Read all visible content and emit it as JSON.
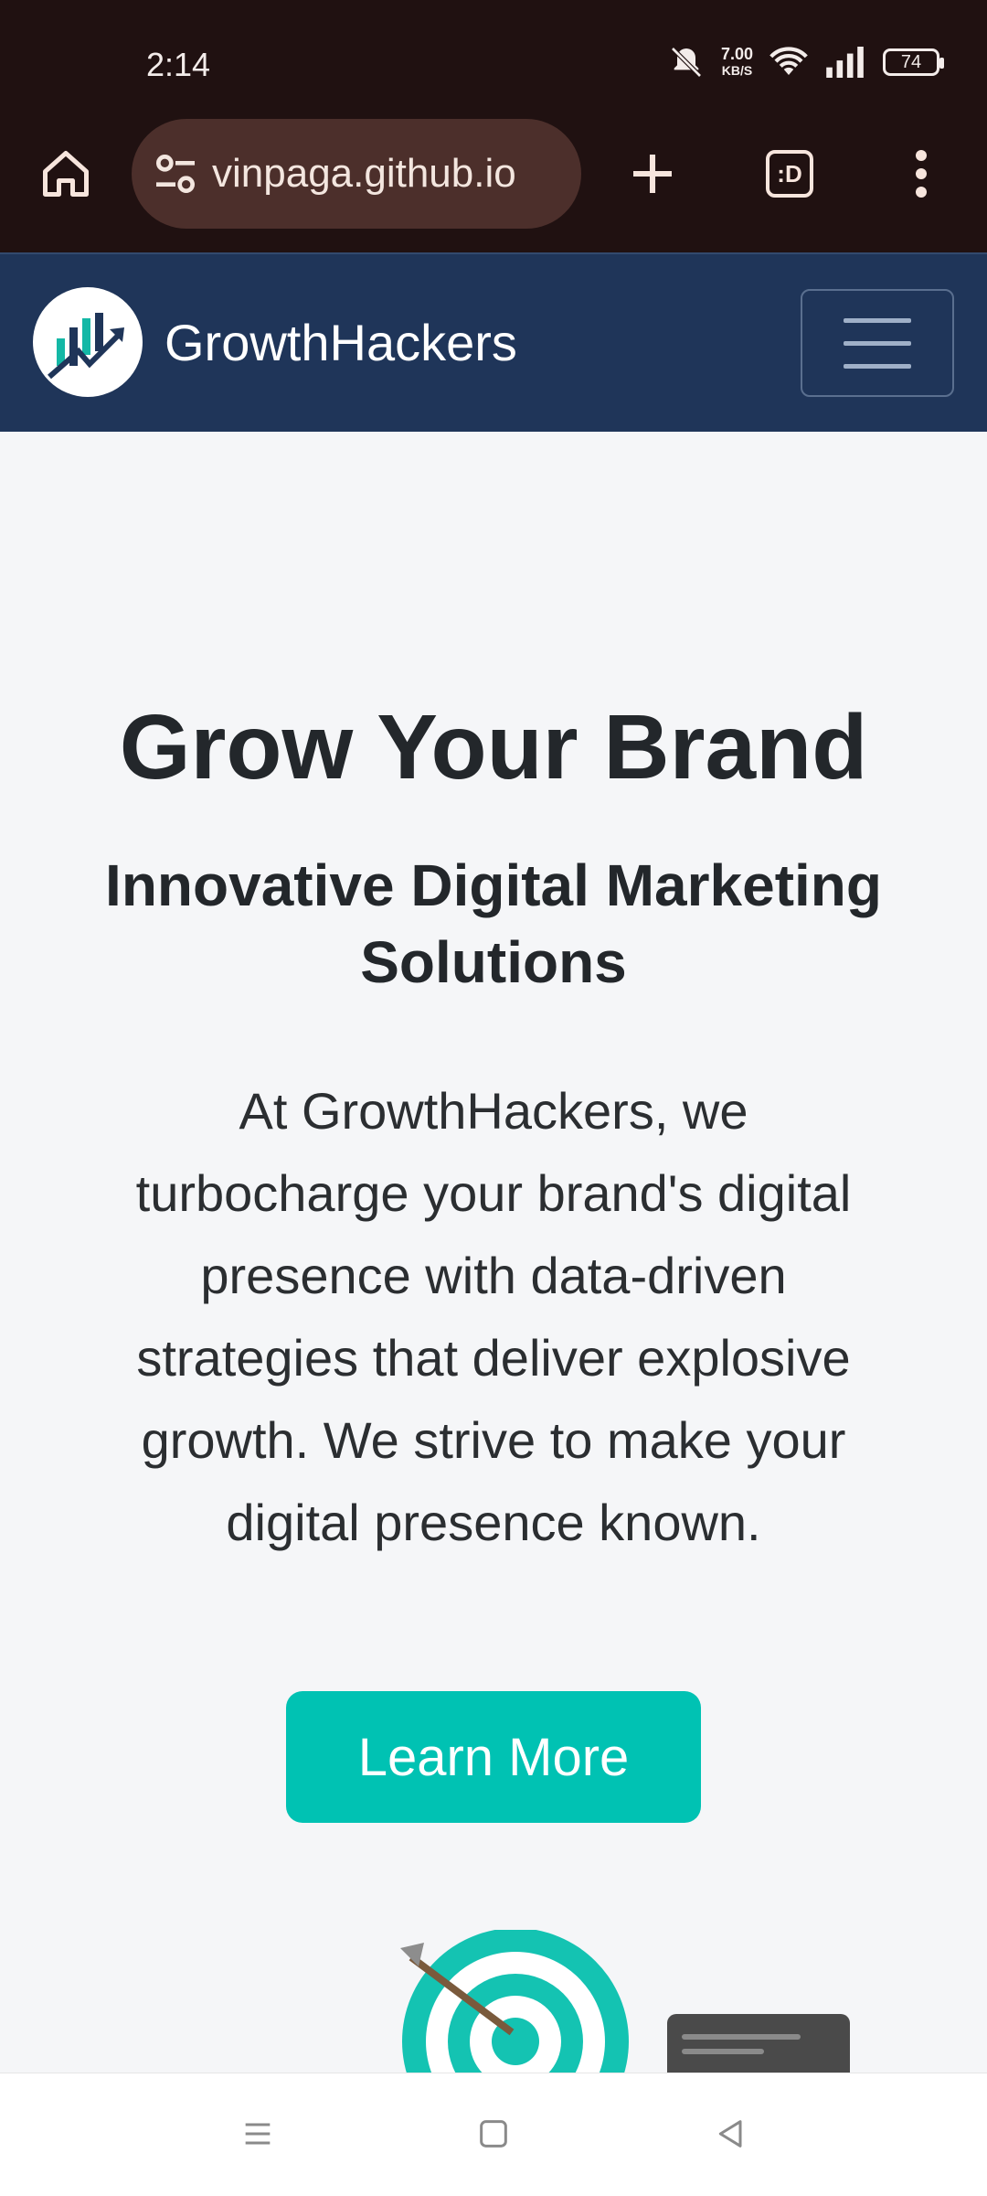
{
  "status_bar": {
    "time": "2:14",
    "speed_value": "7.00",
    "speed_unit": "KB/S",
    "battery": "74"
  },
  "browser": {
    "url": "vinpaga.github.io",
    "tab_label": ":D",
    "icons": [
      "home-icon",
      "site-settings-icon",
      "new-tab-icon",
      "tabs-icon",
      "more-menu-icon"
    ]
  },
  "site_nav": {
    "brand": "GrowthHackers",
    "colors": {
      "navbar": "#1f3559",
      "accent": "#00c2b3"
    }
  },
  "hero": {
    "title": "Grow Your Brand",
    "subtitle": "Innovative Digital Marketing Solutions",
    "description": "At GrowthHackers, we turbocharge your brand's digital presence with data-driven strategies that deliver explosive growth. We strive to make your digital presence known.",
    "cta_label": "Learn More"
  },
  "system_nav": {
    "icons": [
      "recents-icon",
      "home-square-icon",
      "back-triangle-icon"
    ]
  }
}
